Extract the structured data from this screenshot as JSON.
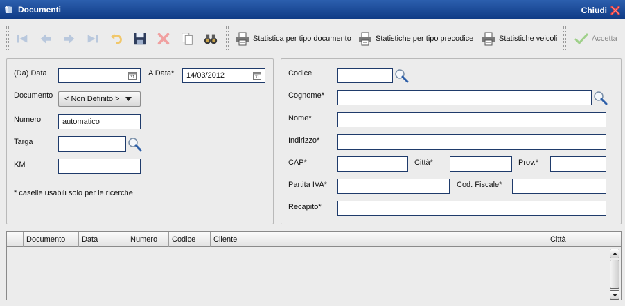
{
  "window": {
    "title": "Documenti",
    "close_label": "Chiudi"
  },
  "toolbar": {
    "nav_icons": [
      "first-icon",
      "prev-icon",
      "next-icon",
      "last-icon",
      "undo-icon",
      "save-icon",
      "delete-icon",
      "copy-icon",
      "search-binoculars-icon"
    ],
    "btn_stat_tipo_documento": "Statistica per tipo documento",
    "btn_stat_tipo_precodice": "Statistiche per tipo precodice",
    "btn_stat_veicoli": "Statistiche veicoli",
    "btn_accetta": "Accetta"
  },
  "left": {
    "da_data_label": "(Da) Data",
    "da_data_value": "",
    "a_data_label": "A Data*",
    "a_data_value": "14/03/2012",
    "documento_label": "Documento",
    "documento_value": "< Non Definito >",
    "numero_label": "Numero",
    "numero_value": "automatico",
    "targa_label": "Targa",
    "targa_value": "",
    "km_label": "KM",
    "km_value": "",
    "note": "* caselle usabili solo per le ricerche"
  },
  "right": {
    "codice_label": "Codice",
    "codice_value": "",
    "cognome_label": "Cognome*",
    "cognome_value": "",
    "nome_label": "Nome*",
    "nome_value": "",
    "indirizzo_label": "Indirizzo*",
    "indirizzo_value": "",
    "cap_label": "CAP*",
    "cap_value": "",
    "citta_label": "Città*",
    "citta_value": "",
    "prov_label": "Prov.*",
    "prov_value": "",
    "piva_label": "Partita IVA*",
    "piva_value": "",
    "cf_label": "Cod. Fiscale*",
    "cf_value": "",
    "recapito_label": "Recapito*",
    "recapito_value": ""
  },
  "grid": {
    "columns": [
      "Documento",
      "Data",
      "Numero",
      "Codice",
      "Cliente",
      "Città"
    ]
  },
  "colors": {
    "title_bar": "#1a4a96",
    "field_border": "#1f3b6b",
    "accept_check": "#7bbf5a"
  }
}
